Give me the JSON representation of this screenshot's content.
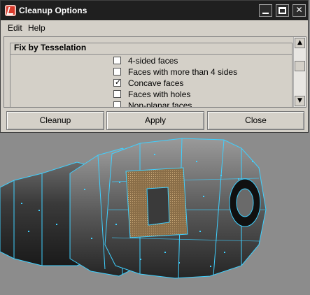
{
  "window": {
    "title": "Cleanup Options",
    "controls": {
      "minimize": "",
      "maximize": "",
      "close": "✕"
    }
  },
  "menu": {
    "items": [
      "Edit",
      "Help"
    ]
  },
  "section": {
    "title": "Fix by Tesselation"
  },
  "checkboxes": [
    {
      "label": "4-sided faces",
      "checked": false
    },
    {
      "label": "Faces with more than 4 sides",
      "checked": false
    },
    {
      "label": "Concave faces",
      "checked": true
    },
    {
      "label": "Faces with holes",
      "checked": false
    },
    {
      "label": "Non-planar faces",
      "checked": false
    }
  ],
  "scrollbar": {
    "up": "▲",
    "down": "▼"
  },
  "buttons": {
    "cleanup": "Cleanup",
    "apply": "Apply",
    "close": "Close"
  },
  "colors": {
    "wire": "#3fd0ff",
    "mesh_dark": "#2a2a2a",
    "mesh_mid": "#5e5e5e",
    "mesh_light": "#8c8c8c",
    "highlight_face": "#b08a5a",
    "viewport_bg": "#8c8c8c"
  }
}
